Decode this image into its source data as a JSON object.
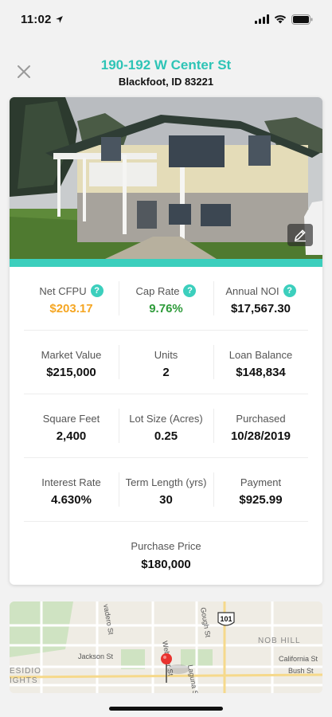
{
  "status": {
    "time": "11:02"
  },
  "header": {
    "title": "190-192 W Center St",
    "subtitle": "Blackfoot, ID 83221"
  },
  "colors": {
    "accent": "#3ccfbd",
    "title": "#2ec4b6",
    "positive_cfpu": "#f5a623",
    "positive_cap": "#2e9b3a"
  },
  "metrics": {
    "row1": [
      {
        "label": "Net CFPU",
        "value": "$203.17",
        "help": true
      },
      {
        "label": "Cap Rate",
        "value": "9.76%",
        "help": true
      },
      {
        "label": "Annual NOI",
        "value": "$17,567.30",
        "help": true
      }
    ],
    "row2": [
      {
        "label": "Market Value",
        "value": "$215,000"
      },
      {
        "label": "Units",
        "value": "2"
      },
      {
        "label": "Loan Balance",
        "value": "$148,834"
      }
    ],
    "row3": [
      {
        "label": "Square Feet",
        "value": "2,400"
      },
      {
        "label": "Lot Size (Acres)",
        "value": "0.25"
      },
      {
        "label": "Purchased",
        "value": "10/28/2019"
      }
    ],
    "row4": [
      {
        "label": "Interest Rate",
        "value": "4.630%"
      },
      {
        "label": "Term Length (yrs)",
        "value": "30"
      },
      {
        "label": "Payment",
        "value": "$925.99"
      }
    ],
    "row5": {
      "label": "Purchase Price",
      "value": "$180,000"
    }
  },
  "map": {
    "labels": {
      "street1": "Jackson St",
      "street2": "Webster St",
      "street3": "Gough St",
      "street4": "Laguna St",
      "street5": "California St",
      "street6": "Bush St",
      "hwy": "101",
      "area1": "NOB HILL",
      "area2": "ESIDIO",
      "area3": "IGHTS",
      "street7": "vadero St"
    }
  },
  "icons": {
    "close": "close-icon",
    "edit": "edit-pencil-icon",
    "help": "help-icon",
    "pin": "map-pin-icon"
  },
  "help_glyph": "?"
}
